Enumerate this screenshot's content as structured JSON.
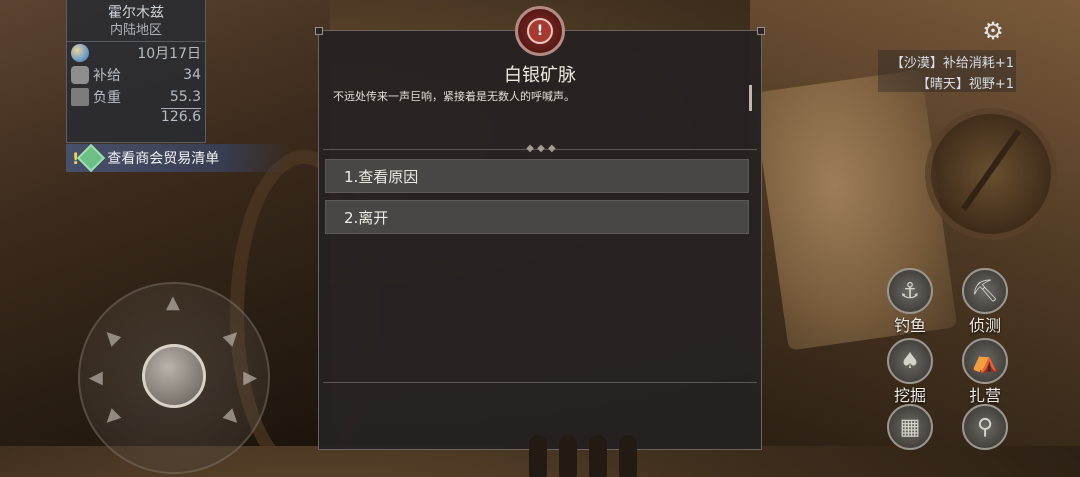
{
  "location": {
    "region": "霍尔木兹",
    "area": "内陆地区",
    "date": "10月17日",
    "supply_label": "补给",
    "supply_value": "34",
    "load_label": "负重",
    "load_current": "55.3",
    "load_capacity": "126.6"
  },
  "quest_banner": {
    "marker": "!",
    "text": "查看商会贸易清单"
  },
  "dialog": {
    "emblem_symbol": "!",
    "title": "白银矿脉",
    "body": "不远处传来一声巨响，紧接着是无数人的呼喊声。",
    "choices": [
      "1.查看原因",
      "2.离开"
    ]
  },
  "status_effects": [
    "【沙漠】补给消耗+1",
    "【晴天】视野+1"
  ],
  "actions": {
    "fish": "钓鱼",
    "scout": "侦测",
    "dig": "挖掘",
    "camp": "扎营"
  },
  "icons": [
    "gear-icon",
    "globe-icon",
    "supply-icon",
    "load-icon",
    "quest-gem-icon",
    "hook-icon",
    "pickaxe-icon",
    "shovel-icon",
    "tent-icon",
    "bag-icon",
    "magnifier-icon"
  ]
}
